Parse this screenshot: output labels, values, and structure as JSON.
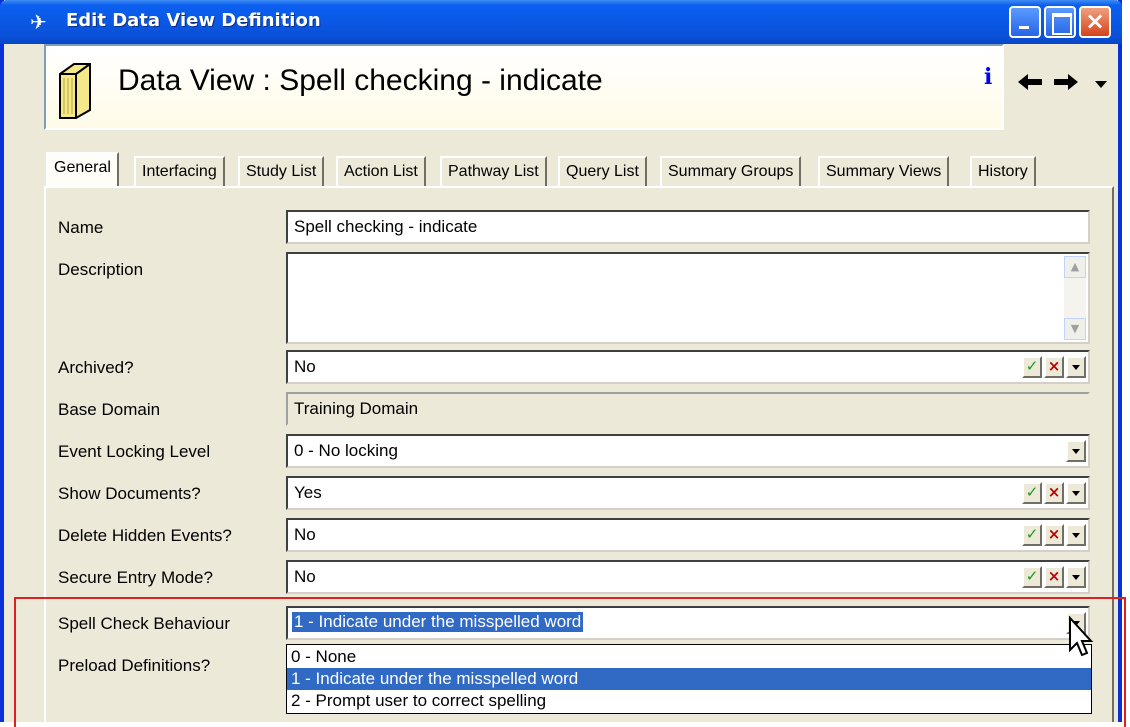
{
  "window": {
    "title": "Edit Data View Definition",
    "buttons": {
      "minimize": "minimize",
      "maximize": "maximize",
      "close": "×"
    }
  },
  "header": {
    "title": "Data View : Spell checking - indicate",
    "icons": {
      "book": "book-icon",
      "info": "i",
      "back": "🡐",
      "forward": "🡒",
      "menu": "▼"
    }
  },
  "tabs": [
    {
      "label": "General",
      "active": true
    },
    {
      "label": "Interfacing"
    },
    {
      "label": "Study List"
    },
    {
      "label": "Action List"
    },
    {
      "label": "Pathway List"
    },
    {
      "label": "Query List"
    },
    {
      "label": "Summary Groups"
    },
    {
      "label": "Summary Views"
    },
    {
      "label": "History"
    }
  ],
  "form": {
    "name": {
      "label": "Name",
      "value": "Spell checking - indicate"
    },
    "description": {
      "label": "Description",
      "value": ""
    },
    "archived": {
      "label": "Archived?",
      "value": "No"
    },
    "base_domain": {
      "label": "Base Domain",
      "value": "Training Domain"
    },
    "event_locking": {
      "label": "Event Locking Level",
      "value": "0 - No locking"
    },
    "show_documents": {
      "label": "Show Documents?",
      "value": "Yes"
    },
    "delete_hidden": {
      "label": "Delete Hidden Events?",
      "value": "No"
    },
    "secure_entry": {
      "label": "Secure Entry Mode?",
      "value": "No"
    },
    "spell_check": {
      "label": "Spell Check Behaviour",
      "value": "1 - Indicate under the misspelled word"
    },
    "preload": {
      "label": "Preload Definitions?"
    }
  },
  "spell_check_options": [
    "0 - None",
    "1 - Indicate under the misspelled word",
    "2 - Prompt user to correct spelling"
  ],
  "highlight_selected_index": 1,
  "colors": {
    "title_bar": "#0a58e5",
    "selection": "#316ac5",
    "annotation": "#e02020",
    "confirm": "#1a9a1a",
    "cancel": "#c00000"
  }
}
